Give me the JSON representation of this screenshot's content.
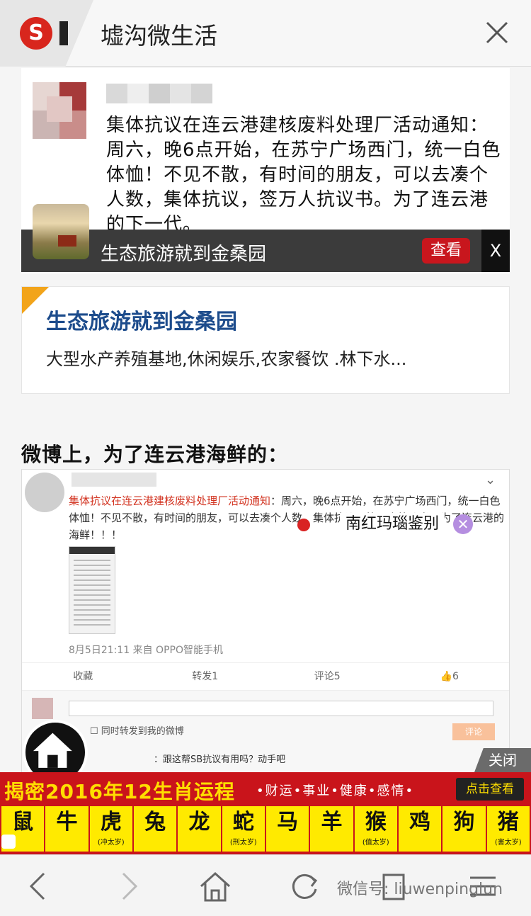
{
  "header": {
    "title": "墟沟微生活"
  },
  "post_quote": {
    "text": "集体抗议在连云港建核废料处理厂活动通知：周六，晚6点开始，在苏宁广场西门，统一白色体恤！不见不散，有时间的朋友，可以去凑个人数，集体抗议，签万人抗议书。为了连云港的下一代。"
  },
  "ad_bar": {
    "text": "生态旅游就到金桑园",
    "view_label": "查看",
    "close_label": "X"
  },
  "ad_card": {
    "title": "生态旅游就到金桑园",
    "desc": "大型水产养殖基地,休闲娱乐,农家餐饮 .林下水..."
  },
  "section_heading": "微博上，为了连云港海鲜的：",
  "weibo": {
    "text_red": "集体抗议在连云港建核废料处理厂活动通知",
    "text_rest": "：周六，晚6点开始，在苏宁广场西门，统一白色体恤！不见不散，有时间的朋友，可以去凑个人数，集体抗议，签万人抗议书。为了连云港的海鲜！！！",
    "meta": "8月5日21:11 来自 OPPO智能手机",
    "actions": [
      "收藏",
      "转发1",
      "评论5",
      "👍6"
    ],
    "checkbox_label": "同时转发到我的微博",
    "submit_label": "评论",
    "reply_text": "：跟这帮SB抗议有用吗？动手吧"
  },
  "floating_tag": {
    "label": "南红玛瑙鉴别",
    "close": "✕"
  },
  "zodiac_banner": {
    "close_label": "关闭",
    "title": "揭密2016年12生肖运程",
    "tags": "•财运•事业•健康•感情•",
    "cta": "点击查看",
    "animals": [
      {
        "ch": "鼠",
        "note": ""
      },
      {
        "ch": "牛",
        "note": ""
      },
      {
        "ch": "虎",
        "note": "(冲太岁)"
      },
      {
        "ch": "兔",
        "note": ""
      },
      {
        "ch": "龙",
        "note": ""
      },
      {
        "ch": "蛇",
        "note": "(刑太岁)"
      },
      {
        "ch": "马",
        "note": ""
      },
      {
        "ch": "羊",
        "note": ""
      },
      {
        "ch": "猴",
        "note": "(值太岁)"
      },
      {
        "ch": "鸡",
        "note": ""
      },
      {
        "ch": "狗",
        "note": ""
      },
      {
        "ch": "猪",
        "note": "(害太岁)"
      }
    ]
  },
  "bottom_nav": {
    "watermark": "微信号: liuwenpinglun"
  },
  "colors": {
    "brand_red": "#c9141b",
    "banner_yellow": "#ffea00",
    "link_blue": "#1d4c8c"
  }
}
